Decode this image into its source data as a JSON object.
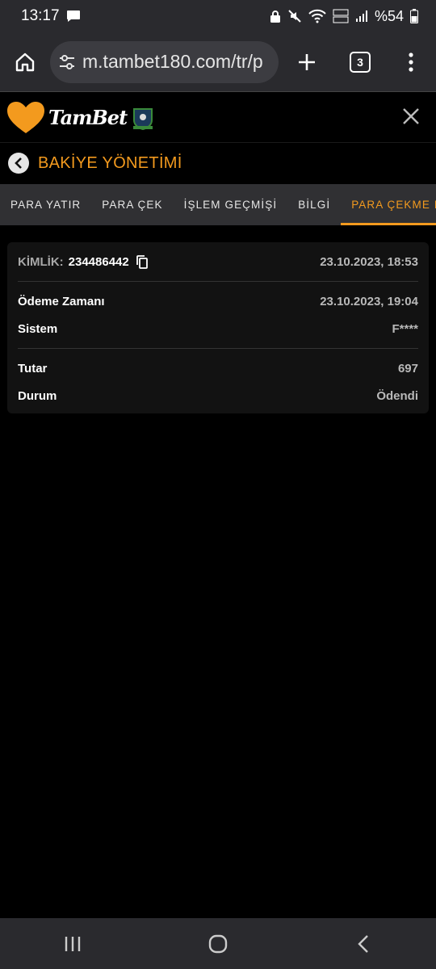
{
  "status": {
    "time": "13:17",
    "battery": "%54"
  },
  "browser": {
    "url": "m.tambet180.com/tr/p",
    "tab_count": "3"
  },
  "site": {
    "logo_text": "TamBet",
    "brand_color": "#f39a1e"
  },
  "page": {
    "title": "BAKİYE YÖNETİMİ"
  },
  "tabs": [
    {
      "label": "PARA YATIR"
    },
    {
      "label": "PARA ÇEK"
    },
    {
      "label": "İŞLEM GEÇMİŞİ"
    },
    {
      "label": "BİLGİ"
    },
    {
      "label": "PARA ÇEKME DURUMU"
    }
  ],
  "transaction": {
    "id_label": "KİMLİK:",
    "id_value": "234486442",
    "created": "23.10.2023, 18:53",
    "payment_time_label": "Ödeme Zamanı",
    "payment_time": "23.10.2023, 19:04",
    "system_label": "Sistem",
    "system": "F****",
    "amount_label": "Tutar",
    "amount": "697",
    "status_label": "Durum",
    "status": "Ödendi",
    "status_color": "#2db531"
  }
}
